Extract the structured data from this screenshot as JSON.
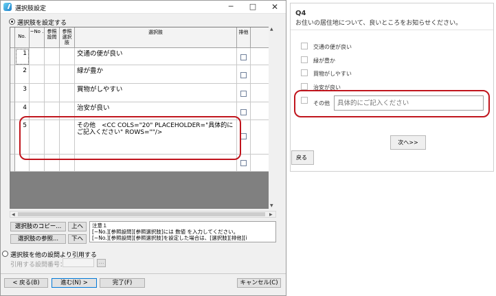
{
  "window": {
    "title": "選択肢設定",
    "minimize": "─",
    "maximize": "□",
    "close": "✕"
  },
  "top_radio": {
    "label": "選択肢を設定する",
    "selected": true
  },
  "grid": {
    "headers": {
      "no": "No.",
      "tilde_no": "~No .",
      "ref_question": "参照 設問",
      "ref_choice": "参照 選択 肢",
      "choice": "選択肢",
      "exclusive": "排他"
    },
    "rows": [
      {
        "no": "1",
        "text": "交通の便が良い"
      },
      {
        "no": "2",
        "text": "緑が豊か"
      },
      {
        "no": "3",
        "text": "買物がしやすい"
      },
      {
        "no": "4",
        "text": "治安が良い"
      },
      {
        "no": "5",
        "text_line1": "その他　<CC COLS=\"20\" PLACEHOLDER=\"具体的に",
        "text_line2": "ご記入ください\" ROWS=\"\"/>"
      }
    ]
  },
  "buttons": {
    "copy_choices": "選択肢のコピー...",
    "up": "上へ",
    "ref_choices": "選択肢の参照...",
    "down": "下へ"
  },
  "note": {
    "line1": "注意１",
    "line2": "[~No.][参照設問][参照選択肢]には 数値 を入力してください。",
    "line3": "[~No.][参照設問][参照選択肢]を設定した場合は、[選択肢][排他][i"
  },
  "bottom_radio": {
    "label": "選択肢を他の設問より引用する",
    "selected": false
  },
  "ref_field": {
    "label": "引用する設問番号：",
    "value": "",
    "browse": "..."
  },
  "footer": {
    "back": "< 戻る(B)",
    "next": "進む(N) >",
    "finish": "完了(F)",
    "cancel": "キャンセル(C)"
  },
  "preview": {
    "question_number": "Q4",
    "question_text": "お住いの居住地について、良いところをお知らせください。",
    "options": [
      "交通の便が良い",
      "緑が豊か",
      "買物がしやすい",
      "治安が良い",
      "その他"
    ],
    "other_placeholder": "具体的にご記入ください",
    "next_button": "次へ>>",
    "back_button": "戻る"
  },
  "colors": {
    "highlight": "#c0141c",
    "grid_bg": "#808080"
  }
}
